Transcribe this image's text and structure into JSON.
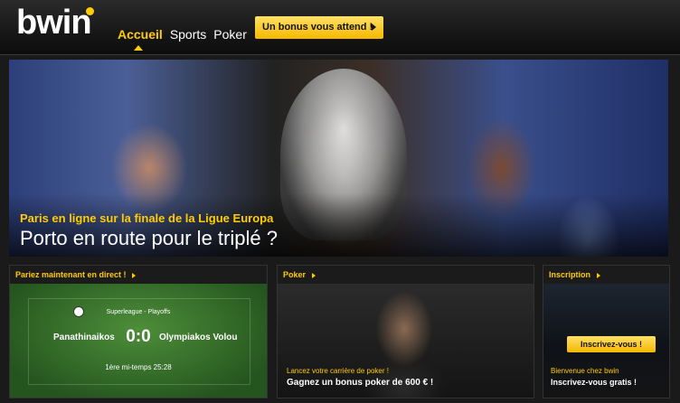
{
  "header": {
    "logo": "bwin",
    "nav": [
      {
        "label": "Accueil",
        "active": true
      },
      {
        "label": "Sports",
        "active": false
      },
      {
        "label": "Poker",
        "active": false
      }
    ],
    "bonus_button": "Un bonus vous attend !"
  },
  "hero": {
    "kicker": "Paris en ligne sur la finale de la Ligue Europa",
    "title": "Porto en route pour le triplé ?"
  },
  "live": {
    "heading": "Pariez maintenant en direct !",
    "league": "Superleague - Playoffs",
    "home_team": "Panathinaikos",
    "score": "0:0",
    "away_team": "Olympiakos Volou",
    "status": "1ère mi-temps 25:28"
  },
  "poker": {
    "heading": "Poker",
    "kicker": "Lancez votre carrière de poker !",
    "title": "Gagnez un bonus poker de 600 € !"
  },
  "signup": {
    "heading": "Inscription",
    "button": "Inscrivez-vous !",
    "kicker": "Bienvenue chez bwin",
    "title": "Inscrivez-vous gratis !"
  },
  "colors": {
    "accent": "#ffcc00",
    "background": "#1a1a1a"
  }
}
